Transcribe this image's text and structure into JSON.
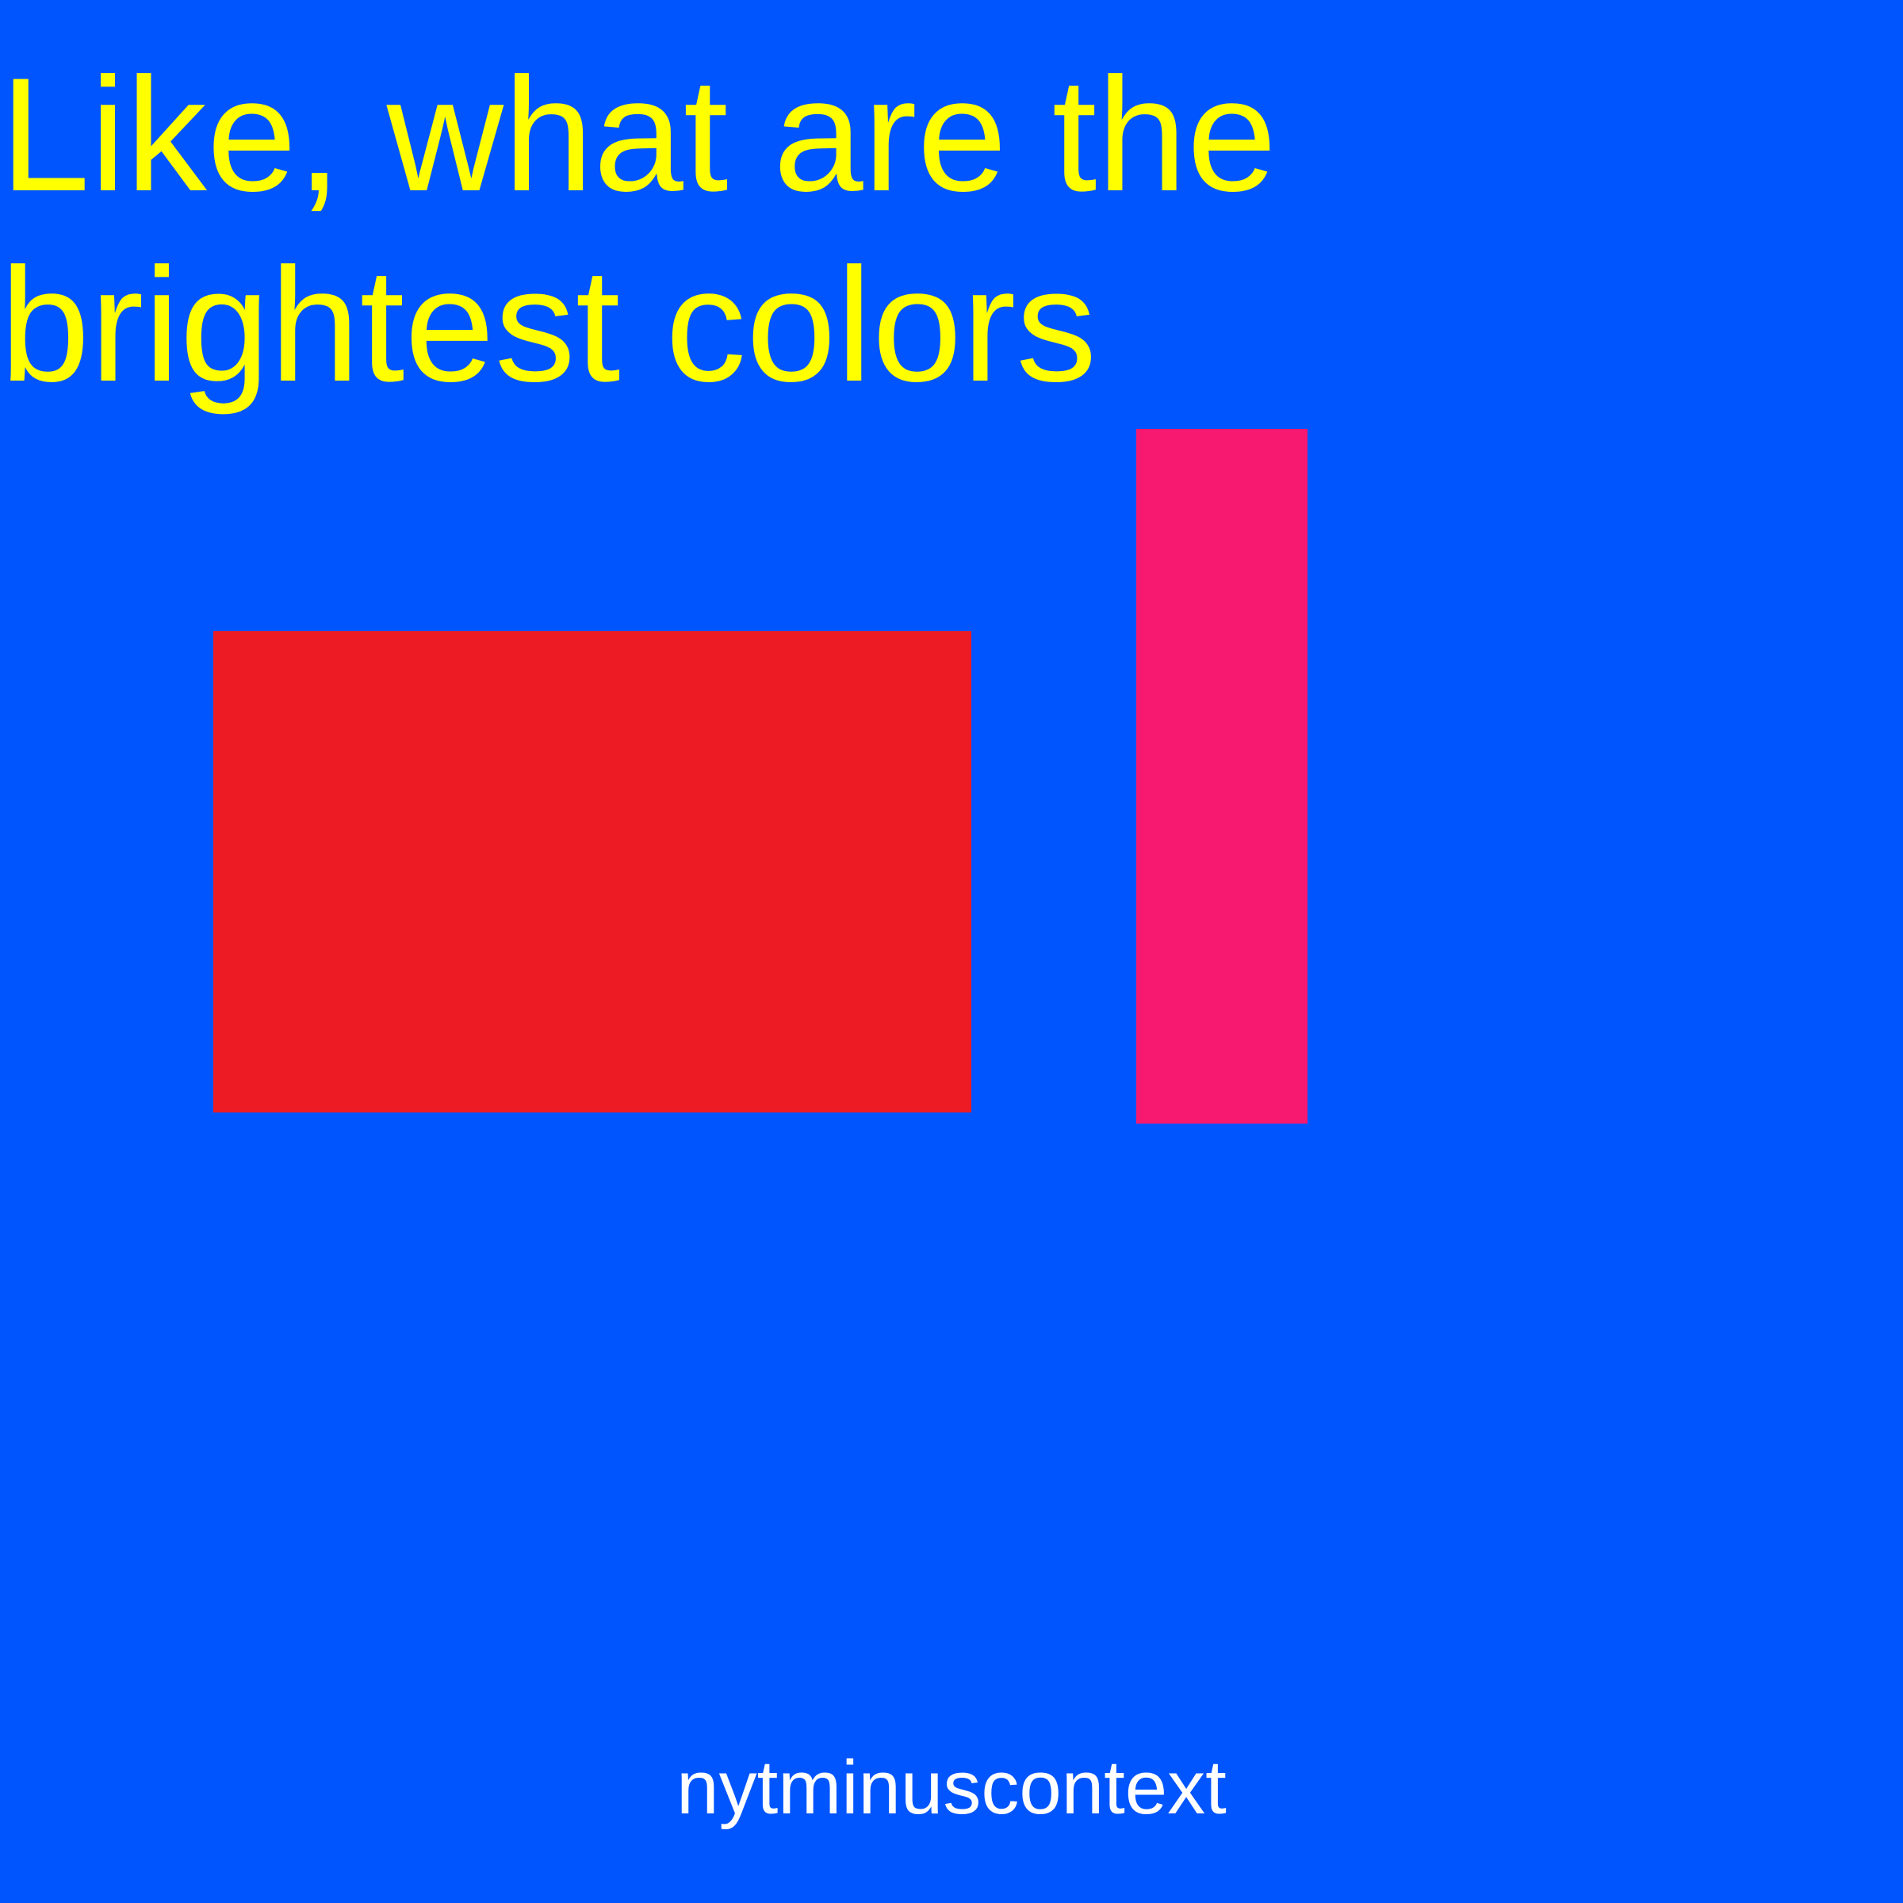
{
  "headline": {
    "line1": "Like, what are the",
    "line2": "brightest colors"
  },
  "handle": "nytminuscontext",
  "colors": {
    "background": "#0055FF",
    "headline_text": "#FFFF00",
    "red_shape": "#ED1C24",
    "pink_shape": "#F7196F",
    "handle_text": "#FFFFFF"
  }
}
